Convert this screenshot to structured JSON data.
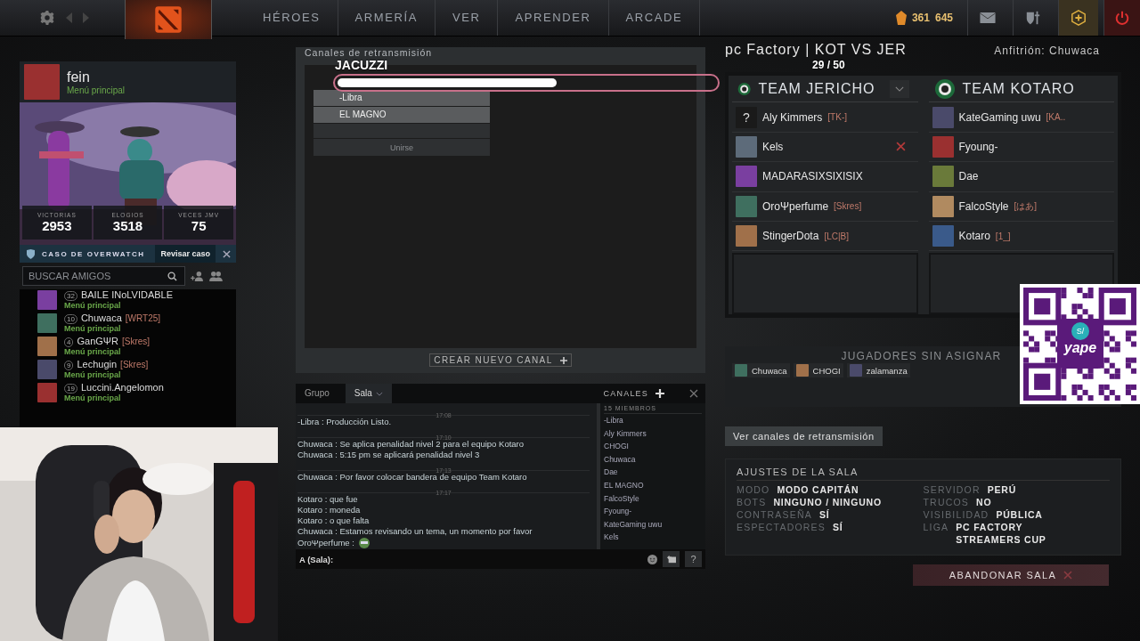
{
  "top_bar": {
    "nav": [
      {
        "label": "HÉROES",
        "selected": false
      },
      {
        "label": "ARMERÍA",
        "selected": false
      },
      {
        "label": "VER",
        "selected": false
      },
      {
        "label": "APRENDER",
        "selected": false
      },
      {
        "label": "ARCADE",
        "selected": false
      }
    ],
    "shards": "361",
    "gold": "645"
  },
  "profile": {
    "name": "fein",
    "status": "Menú principal",
    "stats": [
      {
        "label": "VICTORIAS",
        "value": "2953"
      },
      {
        "label": "ELOGIOS",
        "value": "3518"
      },
      {
        "label": "VECES JMV",
        "value": "75"
      }
    ]
  },
  "overwatch": {
    "title": "CASO DE OVERWATCH",
    "button": "Revisar caso"
  },
  "friends": {
    "search_placeholder": "BUSCAR AMIGOS",
    "items": [
      {
        "level": "32",
        "name": "BAILE INoLVIDABLE",
        "status": "Menú principal"
      },
      {
        "level": "10",
        "name": "Chuwaca",
        "tag": "[WRT25]",
        "status": "Menú principal"
      },
      {
        "level": "4",
        "name": "GanGΨR",
        "tag": "[Skres]",
        "status": "Menú principal"
      },
      {
        "level": "9",
        "name": "Lechugin",
        "tag": "[Skres]",
        "status": "Menú principal"
      },
      {
        "level": "19",
        "name": "Luccini.Angelomon",
        "status": "Menú principal"
      }
    ]
  },
  "broadcast": {
    "title": "Canales de retransmisión",
    "channels": [
      "-Libra",
      "EL MAGNO"
    ],
    "join": "Unirse",
    "create": "CREAR NUEVO CANAL"
  },
  "chat": {
    "tabs": [
      {
        "label": "Grupo",
        "selected": false
      },
      {
        "label": "Sala",
        "selected": true
      }
    ],
    "channels_label": "CANALES",
    "messages": [
      {
        "kind": "time",
        "text": "17:08"
      },
      {
        "kind": "message",
        "text": "-Libra  : Producción Listo."
      },
      {
        "kind": "time",
        "text": "17:10"
      },
      {
        "kind": "message",
        "text": "Chuwaca  : Se aplica penalidad nivel 2 para el equipo Kotaro"
      },
      {
        "kind": "message",
        "text": "Chuwaca  : 5:15 pm se aplicará penalidad nivel 3"
      },
      {
        "kind": "time",
        "text": "17:13"
      },
      {
        "kind": "message",
        "text": "Chuwaca  : Por favor colocar bandera de equipo Team Kotaro"
      },
      {
        "kind": "time",
        "text": "17:17"
      },
      {
        "kind": "message",
        "text": "Kotaro : que fue"
      },
      {
        "kind": "message",
        "text": "Kotaro : moneda"
      },
      {
        "kind": "message",
        "text": "Kotaro : o que falta"
      },
      {
        "kind": "message",
        "text": "Chuwaca  : Estamos revisando un tema, un momento por favor"
      },
      {
        "kind": "emote",
        "text": "OroΨperfume  :"
      }
    ],
    "members_count": "15 MIEMBROS",
    "members": [
      "-Libra",
      "Aly Kimmers",
      "CHOGI",
      "Chuwaca",
      "Dae",
      "EL MAGNO",
      "FalcoStyle",
      "Fyoung-",
      "KateGaming uwu",
      "Kels"
    ],
    "input_label": "A (Sala):",
    "help": "?"
  },
  "lobby": {
    "title": "pc Factory | KOT VS JER",
    "host": "Anfitrión: Chuwaca",
    "teams": [
      {
        "name": "TEAM JERICHO",
        "dropdown": true,
        "players": [
          {
            "avatar": "?",
            "name": "Aly Kimmers",
            "tag": "[TK-]",
            "kickable": false
          },
          {
            "name": "Kels",
            "kickable": true
          },
          {
            "name": "MADARASIXSIXISIX",
            "kickable": false
          },
          {
            "name": "OroΨperfume",
            "tag": "[Skres]",
            "kickable": false
          },
          {
            "name": "StingerDota",
            "tag": "[LC|B]",
            "kickable": false
          }
        ]
      },
      {
        "name": "TEAM KOTARO",
        "dropdown": false,
        "players": [
          {
            "name": "KateGaming uwu",
            "tag": "[KA..",
            "kickable": false
          },
          {
            "name": "Fyoung-",
            "kickable": false
          },
          {
            "name": "Dae",
            "kickable": false
          },
          {
            "name": "FalcoStyle",
            "tag": "[はあ]",
            "kickable": false
          },
          {
            "name": "Kotaro",
            "tag": "[1_]",
            "kickable": false
          }
        ]
      }
    ],
    "unassigned_title": "JUGADORES SIN ASIGNAR",
    "unassigned": [
      "Chuwaca",
      "CHOGI",
      "zalamanza"
    ],
    "broadcast_button": "Ver canales de retransmisión",
    "settings_title": "AJUSTES DE LA SALA",
    "settings_left": [
      {
        "label": "MODO",
        "value": "MODO CAPITÁN"
      },
      {
        "label": "BOTS",
        "value": "NINGUNO / NINGUNO"
      },
      {
        "label": "CONTRASEÑA",
        "value": "SÍ"
      },
      {
        "label": "ESPECTADORES",
        "value": "SÍ"
      }
    ],
    "settings_right": [
      {
        "label": "SERVIDOR",
        "value": "PERÚ"
      },
      {
        "label": "TRUCOS",
        "value": "NO"
      },
      {
        "label": "VISIBILIDAD",
        "value": "PÚBLICA"
      },
      {
        "label": "LIGA",
        "value": "PC FACTORY STREAMERS CUP"
      }
    ],
    "leave": "ABANDONAR SALA"
  },
  "stream_goal": {
    "title": "JACUZZI",
    "count": "29 / 50",
    "level": 0.58
  },
  "qr": {
    "badge": "S/",
    "logo": "yape"
  }
}
